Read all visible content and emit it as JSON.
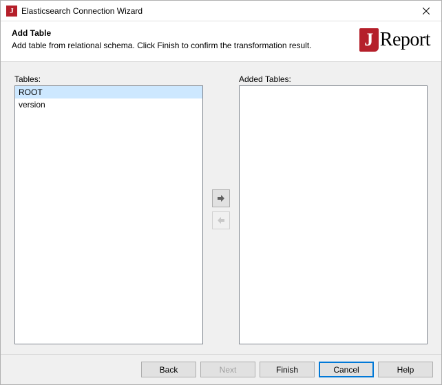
{
  "window": {
    "title": "Elasticsearch Connection Wizard"
  },
  "header": {
    "title": "Add Table",
    "description": "Add table from relational schema. Click Finish to confirm the transformation result.",
    "logo_j": "J",
    "logo_text": "Report"
  },
  "content": {
    "tables_label": "Tables:",
    "added_label": "Added Tables:",
    "tables": [
      {
        "name": "ROOT",
        "selected": true
      },
      {
        "name": "version",
        "selected": false
      }
    ],
    "added_tables": []
  },
  "footer": {
    "back": "Back",
    "next": "Next",
    "finish": "Finish",
    "cancel": "Cancel",
    "help": "Help"
  }
}
